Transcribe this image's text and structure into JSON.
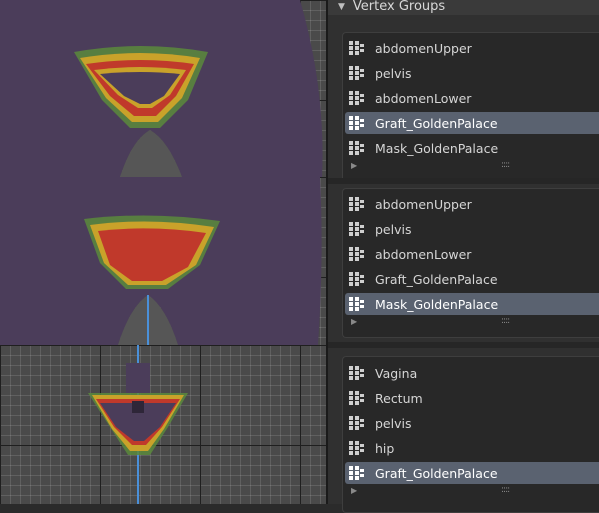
{
  "panel": {
    "title": "Vertex Groups"
  },
  "lists": [
    {
      "items": [
        {
          "label": "abdomenUpper",
          "selected": false
        },
        {
          "label": "pelvis",
          "selected": false
        },
        {
          "label": "abdomenLower",
          "selected": false
        },
        {
          "label": "Graft_GoldenPalace",
          "selected": true
        },
        {
          "label": "Mask_GoldenPalace",
          "selected": false
        }
      ],
      "grip": "::::"
    },
    {
      "items": [
        {
          "label": "abdomenUpper",
          "selected": false
        },
        {
          "label": "pelvis",
          "selected": false
        },
        {
          "label": "abdomenLower",
          "selected": false
        },
        {
          "label": "Graft_GoldenPalace",
          "selected": false
        },
        {
          "label": "Mask_GoldenPalace",
          "selected": true
        }
      ],
      "grip": "::::"
    },
    {
      "items": [
        {
          "label": "Vagina",
          "selected": false
        },
        {
          "label": "Rectum",
          "selected": false
        },
        {
          "label": "pelvis",
          "selected": false
        },
        {
          "label": "hip",
          "selected": false
        },
        {
          "label": "Graft_GoldenPalace",
          "selected": true
        }
      ],
      "grip": "::::"
    }
  ],
  "colors": {
    "skin": "#4b3d5a",
    "weight_red": "#c0392b",
    "weight_yellow": "#c9a22a",
    "weight_green": "#5a8a3c",
    "selected_row": "#5a6270",
    "bone_line": "#4a90d9"
  }
}
